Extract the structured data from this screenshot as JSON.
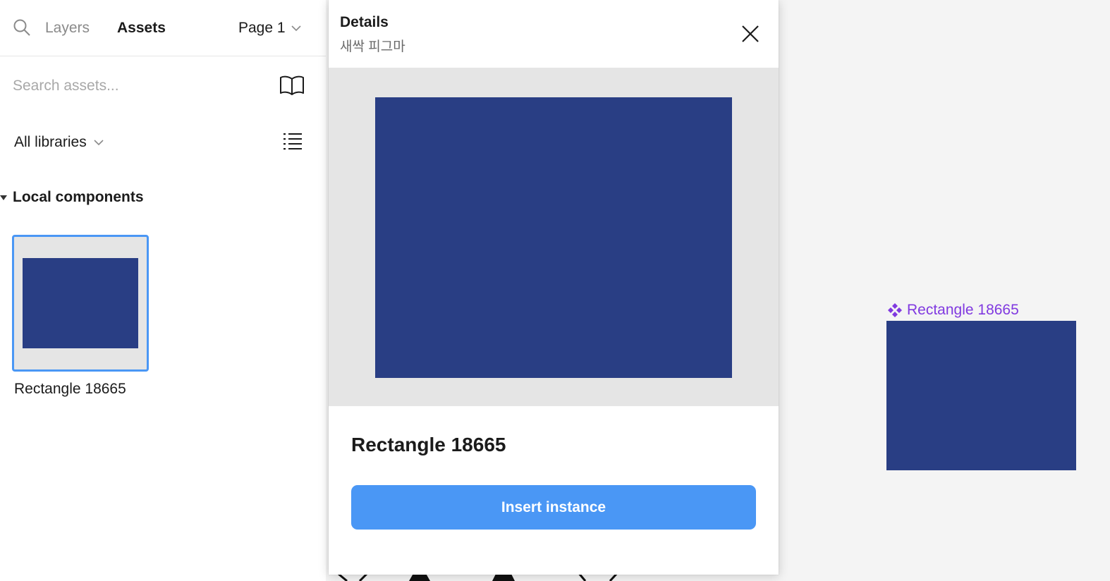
{
  "colors": {
    "component_fill": "#293e84",
    "accent_blue": "#4a97f5",
    "component_purple": "#8039e0",
    "panel_bg": "#ffffff",
    "canvas_bg": "#f4f4f4"
  },
  "sidebar": {
    "search_icon": "search-icon",
    "tabs": [
      {
        "label": "Layers",
        "active": false
      },
      {
        "label": "Assets",
        "active": true
      }
    ],
    "page_select": "Page 1",
    "search": {
      "placeholder": "Search assets..."
    },
    "library_icon": "book-icon",
    "libraries_select": "All libraries",
    "view_toggle_icon": "list-view-icon",
    "section": {
      "title": "Local components"
    },
    "components": [
      {
        "label": "Rectangle 18665",
        "selected": true
      }
    ]
  },
  "details": {
    "title": "Details",
    "subtitle": "새싹 피그마",
    "close_icon": "close-icon",
    "component_name": "Rectangle 18665",
    "insert_label": "Insert instance"
  },
  "canvas": {
    "component_label": "Rectangle 18665",
    "component_icon": "component-icon"
  }
}
